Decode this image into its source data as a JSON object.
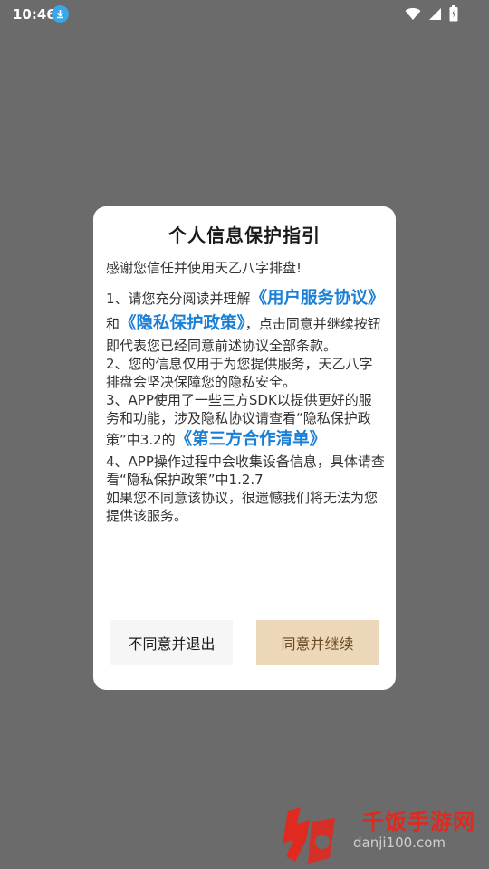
{
  "status_bar": {
    "time": "10:46"
  },
  "dialog": {
    "title": "个人信息保护指引",
    "intro": "感谢您信任并使用天乙八字排盘!",
    "item1_pre": "1、请您充分阅读并理解",
    "link_user_agreement": "《用户服务协议》",
    "item1_and": "和",
    "link_privacy_policy": "《隐私保护政策》",
    "item1_post": "，点击同意并继续按钮即代表您已经同意前述协议全部条款。",
    "item2": "2、您的信息仅用于为您提供服务，天乙八字排盘会坚决保障您的隐私安全。",
    "item3_pre": "3、APP使用了一些三方SDK以提供更好的服务和功能，涉及隐私协议请查看“隐私保护政策”中3.2的",
    "link_third_party": "《第三方合作清单》",
    "item4": "4、APP操作过程中会收集设备信息，具体请查看“隐私保护政策”中1.2.7",
    "closing": "如果您不同意该协议，很遗憾我们将无法为您提供该服务。",
    "disagree_label": "不同意并退出",
    "agree_label": "同意并继续"
  },
  "watermark": {
    "brand": "千饭手游网",
    "site": "danji100.com"
  },
  "colors": {
    "link": "#1a7fd6",
    "agree_bg": "#ecd7b8",
    "overlay": "#6b6b6b"
  },
  "icons": {
    "download": "download-icon",
    "wifi": "wifi-icon",
    "signal": "signal-icon",
    "battery": "battery-icon"
  }
}
